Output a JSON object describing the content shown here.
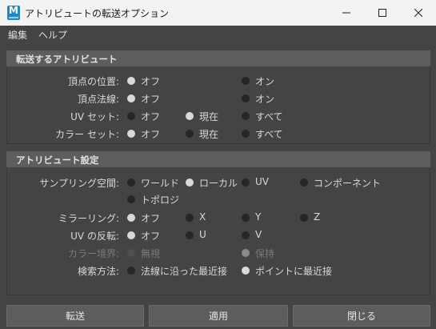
{
  "window": {
    "title": "アトリビュートの転送オプション",
    "app_icon_letter": "M"
  },
  "menu": {
    "items": [
      "編集",
      "ヘルプ"
    ]
  },
  "transfer_section": {
    "header": "転送するアトリビュート",
    "rows": [
      {
        "label": "頂点の位置:",
        "options": [
          "オフ",
          "オン"
        ],
        "selected": "オフ"
      },
      {
        "label": "頂点法線:",
        "options": [
          "オフ",
          "オン"
        ],
        "selected": "オフ"
      },
      {
        "label": "UV セット:",
        "options": [
          "オフ",
          "現在",
          "すべて"
        ],
        "selected": "現在"
      },
      {
        "label": "カラー セット:",
        "options": [
          "オフ",
          "現在",
          "すべて"
        ],
        "selected": "オフ"
      }
    ]
  },
  "settings_section": {
    "header": "アトリビュート設定",
    "sampling": {
      "label": "サンプリング空間:",
      "options": [
        "ワールド",
        "ローカル",
        "UV",
        "コンポーネント",
        "トポロジ"
      ],
      "selected": "ローカル"
    },
    "mirroring": {
      "label": "ミラーリング:",
      "options": [
        "オフ",
        "X",
        "Y",
        "Z"
      ],
      "selected": "オフ"
    },
    "uv_flip": {
      "label": "UV の反転:",
      "options": [
        "オフ",
        "U",
        "V"
      ],
      "selected": "オフ"
    },
    "color_borders": {
      "label": "カラー境界:",
      "options": [
        "無視",
        "保持"
      ],
      "selected": "保持",
      "disabled": true
    },
    "search_method": {
      "label": "検索方法:",
      "options": [
        "法線に沿った最近接",
        "ポイントに最近接"
      ],
      "selected": "ポイントに最近接"
    }
  },
  "buttons": {
    "transfer": "転送",
    "apply": "適用",
    "close": "閉じる"
  }
}
